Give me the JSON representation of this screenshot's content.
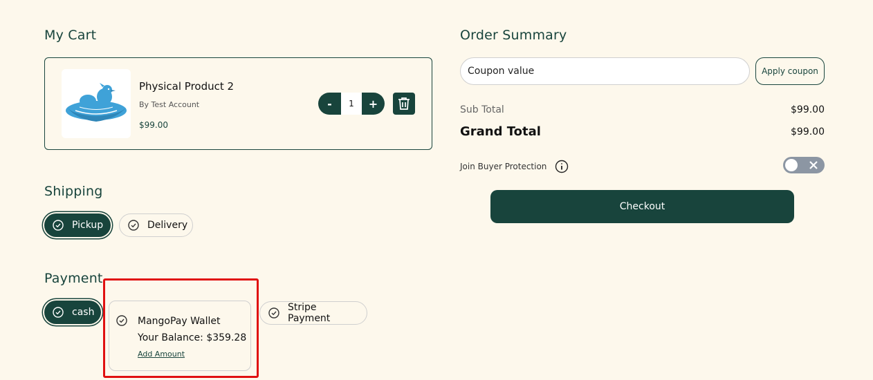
{
  "cart": {
    "title": "My Cart",
    "item": {
      "name": "Physical Product 2",
      "seller": "By Test Account",
      "price": "$99.00",
      "quantity": "1",
      "minus_label": "-",
      "plus_label": "+"
    }
  },
  "shipping": {
    "title": "Shipping",
    "options": [
      {
        "label": "Pickup",
        "selected": true
      },
      {
        "label": "Delivery",
        "selected": false
      }
    ]
  },
  "payment": {
    "title": "Payment",
    "options": [
      {
        "label": "cash",
        "selected": true
      },
      {
        "label": "MangoPay Wallet",
        "balance": "Your Balance: $359.28",
        "link": "Add Amount",
        "selected": false
      },
      {
        "label": "Stripe Payment",
        "selected": false
      }
    ]
  },
  "summary": {
    "title": "Order Summary",
    "coupon_placeholder": "Coupon value",
    "apply_label": "Apply coupon",
    "subtotal_label": "Sub Total",
    "subtotal_value": "$99.00",
    "grandtotal_label": "Grand Total",
    "grandtotal_value": "$99.00",
    "protection_label": "Join Buyer Protection",
    "protection_enabled": false,
    "checkout_label": "Checkout"
  },
  "colors": {
    "brand": "#18443c",
    "background": "#fdf8ec",
    "highlight": "#e01010",
    "logo": "#3fa2d8"
  },
  "icons": [
    "bird-nest-logo",
    "trash-icon",
    "check-circle-icon",
    "info-icon",
    "close-icon"
  ]
}
